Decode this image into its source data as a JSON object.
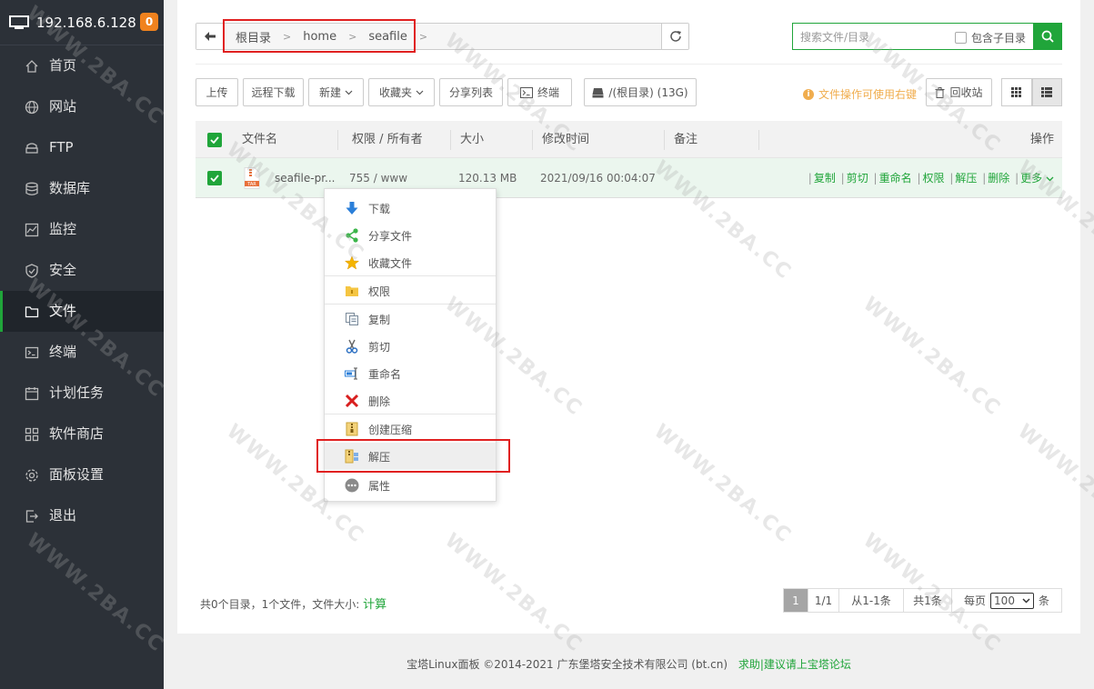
{
  "sidebar": {
    "host": "192.168.6.128",
    "badge": "0",
    "items": [
      {
        "label": "首页",
        "icon": "home-icon"
      },
      {
        "label": "网站",
        "icon": "globe-icon"
      },
      {
        "label": "FTP",
        "icon": "ftp-icon"
      },
      {
        "label": "数据库",
        "icon": "database-icon"
      },
      {
        "label": "监控",
        "icon": "monitor-chart-icon"
      },
      {
        "label": "安全",
        "icon": "shield-icon"
      },
      {
        "label": "文件",
        "icon": "folder-icon",
        "active": true
      },
      {
        "label": "终端",
        "icon": "terminal-icon"
      },
      {
        "label": "计划任务",
        "icon": "calendar-icon"
      },
      {
        "label": "软件商店",
        "icon": "apps-grid-icon"
      },
      {
        "label": "面板设置",
        "icon": "gear-icon"
      },
      {
        "label": "退出",
        "icon": "logout-icon"
      }
    ]
  },
  "breadcrumb": {
    "items": [
      "根目录",
      "home",
      "seafile"
    ]
  },
  "search": {
    "placeholder": "搜索文件/目录",
    "include_sub": "包含子目录"
  },
  "toolbar": {
    "upload": "上传",
    "remote_download": "远程下载",
    "new": "新建",
    "favorites": "收藏夹",
    "share_list": "分享列表",
    "terminal": "终端",
    "disk": "/(根目录) (13G)",
    "tip": "文件操作可使用右键",
    "recycle": "回收站"
  },
  "table": {
    "headers": {
      "name": "文件名",
      "perm": "权限 / 所有者",
      "size": "大小",
      "mtime": "修改时间",
      "note": "备注",
      "ops": "操作"
    },
    "rows": [
      {
        "name": "seafile-pr...",
        "perm": "755 / www",
        "size": "120.13 MB",
        "mtime": "2021/09/16 00:04:07",
        "ops": [
          "复制",
          "剪切",
          "重命名",
          "权限",
          "解压",
          "删除",
          "更多"
        ]
      }
    ]
  },
  "context_menu": {
    "items": [
      {
        "label": "下载",
        "icon": "download-arrow-icon"
      },
      {
        "label": "分享文件",
        "icon": "share-icon"
      },
      {
        "label": "收藏文件",
        "icon": "star-icon"
      },
      {
        "label": "权限",
        "icon": "permission-folder-icon"
      },
      {
        "label": "复制",
        "icon": "copy-icon"
      },
      {
        "label": "剪切",
        "icon": "scissors-icon"
      },
      {
        "label": "重命名",
        "icon": "rename-icon"
      },
      {
        "label": "删除",
        "icon": "delete-x-icon"
      },
      {
        "label": "创建压缩",
        "icon": "zip-icon"
      },
      {
        "label": "解压",
        "icon": "unzip-icon",
        "highlighted": true
      },
      {
        "label": "属性",
        "icon": "more-dots-icon"
      }
    ]
  },
  "summary": {
    "text": "共0个目录，1个文件，文件大小:",
    "calc": "计算"
  },
  "pager": {
    "current": "1",
    "pages": "1/1",
    "range": "从1-1条",
    "total": "共1条",
    "per_page_label": "每页",
    "per_page": "100",
    "unit": "条"
  },
  "footer": {
    "copyright": "宝塔Linux面板 ©2014-2021 广东堡塔安全技术有限公司 (bt.cn)",
    "link": "求助|建议请上宝塔论坛"
  },
  "watermark": "WWW.2BA.CC",
  "colors": {
    "accent": "#20a53a",
    "sidebar": "#2c3138",
    "warning": "#f0ad4e",
    "badge": "#f0821e",
    "highlight_box": "#e02020"
  }
}
